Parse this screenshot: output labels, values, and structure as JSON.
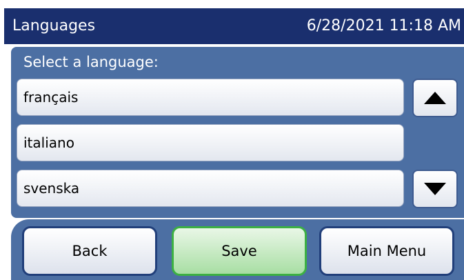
{
  "header": {
    "title": "Languages",
    "datetime": "6/28/2021 11:18 AM"
  },
  "prompt": "Select a language:",
  "languages": [
    "français",
    "italiano",
    "svenska"
  ],
  "scroll": {
    "up_icon": "triangle-up",
    "down_icon": "triangle-down"
  },
  "buttons": {
    "back": "Back",
    "save": "Save",
    "main_menu": "Main Menu"
  },
  "colors": {
    "header_bg": "#1a2f6e",
    "panel_bg": "#4c6fa3",
    "save_border": "#3cb043",
    "button_border": "#213f7a"
  }
}
